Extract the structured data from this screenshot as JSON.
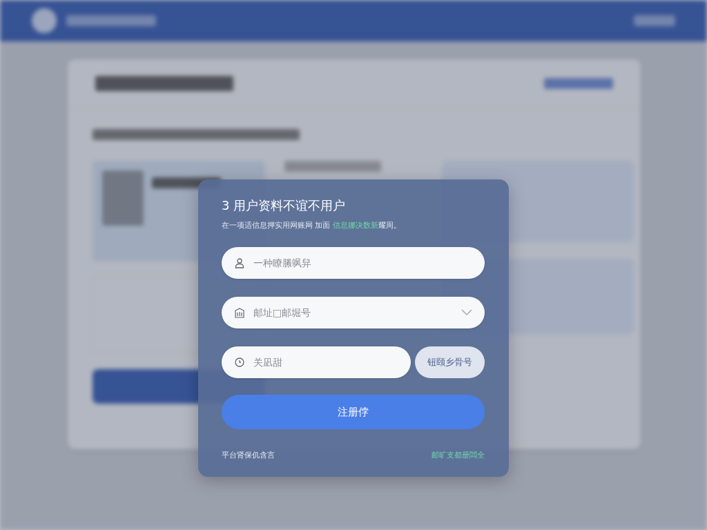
{
  "dialog": {
    "title": "3 用户资料不谊不用户",
    "subtitle": {
      "before": "在一项适信息押实用网账网 加面 ",
      "link": "信息娜决数新",
      "after": "耀周。"
    },
    "fields": [
      {
        "kind": "text",
        "placeholder": "一种瞭縢飒舁"
      },
      {
        "kind": "select",
        "placeholder": "邮址□邮堀号"
      },
      {
        "kind": "code",
        "placeholder": "关凪甜",
        "button": "钮颐乡骨号"
      }
    ],
    "submit": "注册侼",
    "footer": {
      "left": "平台肾保仉含言",
      "right": "邮旷支都册闆全"
    }
  }
}
